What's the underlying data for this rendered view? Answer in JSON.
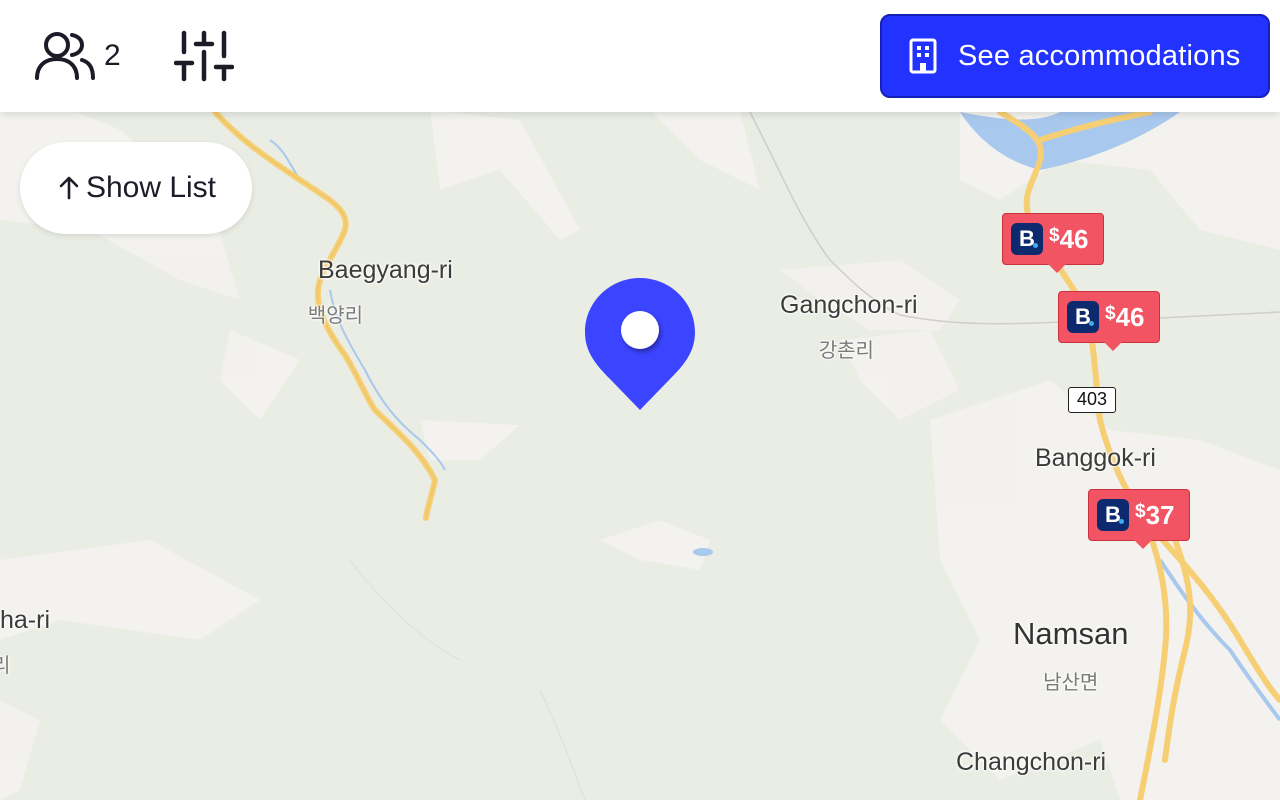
{
  "topbar": {
    "guests": {
      "icon": "users-icon",
      "count": "2"
    },
    "filters": {
      "icon": "sliders-icon"
    },
    "cta": {
      "icon": "building-icon",
      "label": "See accommodations",
      "color": "#2233ff"
    }
  },
  "show_list": {
    "icon": "arrow-up-icon",
    "label": "Show List"
  },
  "map": {
    "background": "#e9ede3",
    "road_color": "#f6cf75",
    "water_color": "#a9c8ee",
    "places": [
      {
        "id": "baegyang",
        "name": "Baegyang-ri",
        "native": "백양리"
      },
      {
        "id": "gangchon",
        "name": "Gangchon-ri",
        "native": "강촌리"
      },
      {
        "id": "banggok",
        "name": "Banggok-ri"
      },
      {
        "id": "namsan",
        "name": "Namsan",
        "native": "남산면"
      },
      {
        "id": "changchon",
        "name": "Changchon-ri"
      },
      {
        "id": "hari",
        "name": "ha-ri",
        "native": "리"
      }
    ],
    "road_badge": "403",
    "price_markers": [
      {
        "brand": "B",
        "currency": "$",
        "amount": "46"
      },
      {
        "brand": "B",
        "currency": "$",
        "amount": "46"
      },
      {
        "brand": "B",
        "currency": "$",
        "amount": "37"
      }
    ],
    "selected_pin": {
      "icon": "location-pin-icon",
      "color": "#3b44ff"
    }
  }
}
